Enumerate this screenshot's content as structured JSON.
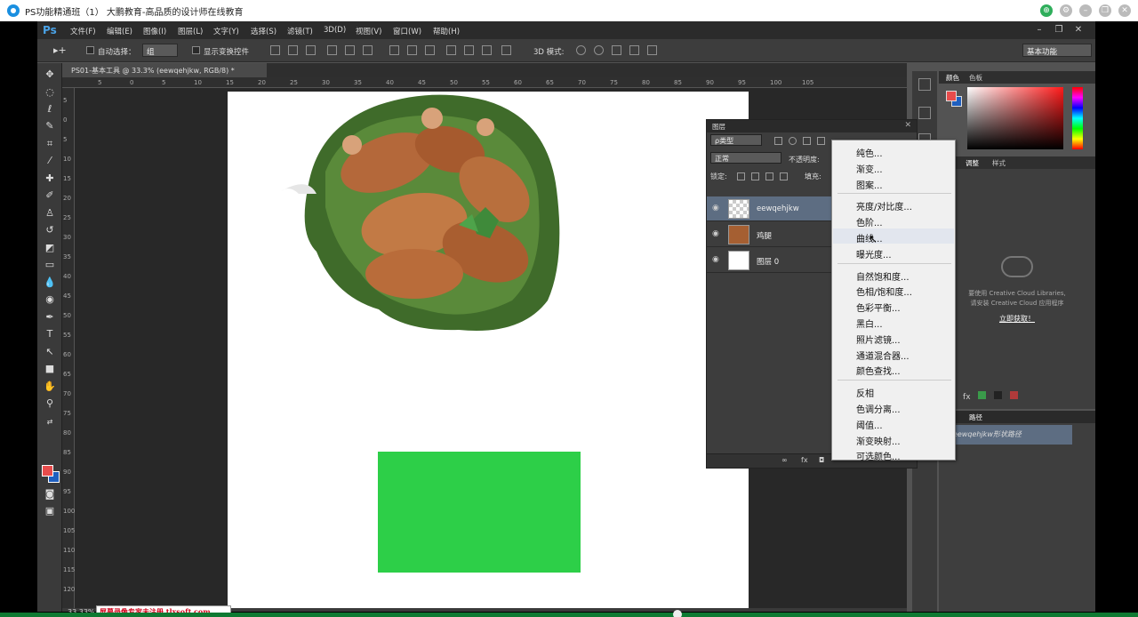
{
  "window": {
    "title": "PS功能精通班（1） 大鹏教育-高品质的设计师在线教育",
    "buttons": [
      "⊕",
      "⚙",
      "–",
      "❐",
      "✕"
    ],
    "button_colors": [
      "#2fae5b",
      "#bbb",
      "#bbb",
      "#bbb",
      "#bbb"
    ]
  },
  "ps": {
    "logo": "Ps",
    "menu": [
      "文件(F)",
      "编辑(E)",
      "图像(I)",
      "图层(L)",
      "文字(Y)",
      "选择(S)",
      "滤镜(T)",
      "3D(D)",
      "视图(V)",
      "窗口(W)",
      "帮助(H)"
    ],
    "options": {
      "auto_select_label": "自动选择：",
      "auto_select_value": "组",
      "show_transform_label": "显示变换控件",
      "mode_3d_label": "3D 模式:",
      "workspace": "基本功能"
    },
    "doc_tab": "PS01-基本工具 @ 33.3% (eewqehjkw, RGB/8) *",
    "ruler_h_ticks": [
      "5",
      "0",
      "5",
      "10",
      "15",
      "20",
      "25",
      "30",
      "35",
      "40",
      "45",
      "50",
      "55",
      "60",
      "65",
      "70",
      "75",
      "80",
      "85",
      "90",
      "95",
      "100",
      "105"
    ],
    "ruler_v_ticks": [
      "5",
      "0",
      "5",
      "10",
      "15",
      "20",
      "25",
      "30",
      "35",
      "40",
      "45",
      "50",
      "55",
      "60",
      "65",
      "70",
      "75",
      "80",
      "85",
      "90",
      "95",
      "100",
      "105",
      "110",
      "115",
      "120"
    ],
    "zoom": "33.33%"
  },
  "color_panel": {
    "tabs": [
      "颜色",
      "色板"
    ],
    "fg": "#e84c4c",
    "bg": "#1f5fbf"
  },
  "adjust_panel": {
    "tabs": [
      "调整",
      "样式"
    ]
  },
  "libraries": {
    "message_line1": "要使用 Creative Cloud Libraries,",
    "message_line2": "请安装 Creative Cloud 应用程序",
    "link": "立即获取！"
  },
  "paths_panel": {
    "tab": "路径",
    "path_name": "eewqehjkw形状路径"
  },
  "layers_panel": {
    "title": "图层",
    "filter": "ρ类型",
    "blend_mode": "正常",
    "opacity_label": "不透明度:",
    "lock_label": "锁定:",
    "fill_label": "填充:",
    "layers": [
      {
        "name": "eewqehjkw",
        "selected": true
      },
      {
        "name": "鸡腿",
        "selected": false
      },
      {
        "name": "图层 0",
        "selected": false
      }
    ],
    "footer_icons": [
      "∞",
      "fx",
      "◘"
    ]
  },
  "context_menu": {
    "groups": [
      [
        "纯色...",
        "渐变...",
        "图案..."
      ],
      [
        "亮度/对比度...",
        "色阶...",
        "曲线...",
        "曝光度..."
      ],
      [
        "自然饱和度...",
        "色相/饱和度...",
        "色彩平衡...",
        "黑白...",
        "照片滤镜...",
        "通道混合器...",
        "颜色查找..."
      ],
      [
        "反相",
        "色调分离...",
        "阈值...",
        "渐变映射...",
        "可选颜色..."
      ]
    ],
    "hovered": "曲线..."
  },
  "watermark": "屏幕录像专家未注册 tlxsoft.com",
  "canvas": {
    "green_rect_color": "#2dcf48"
  }
}
